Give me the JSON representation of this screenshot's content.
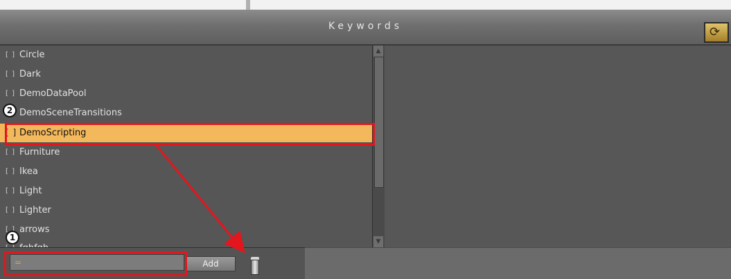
{
  "header": {
    "title": "Keywords"
  },
  "keywords": [
    {
      "check": "[ ]",
      "label": "Circle"
    },
    {
      "check": "[ ]",
      "label": "Dark"
    },
    {
      "check": "[ ]",
      "label": "DemoDataPool"
    },
    {
      "check": "[ ]",
      "label": "DemoSceneTransitions"
    },
    {
      "check": "[ ]",
      "label": "DemoScripting"
    },
    {
      "check": "[ ]",
      "label": "Furniture"
    },
    {
      "check": "[ ]",
      "label": "Ikea"
    },
    {
      "check": "[ ]",
      "label": "Light"
    },
    {
      "check": "[ ]",
      "label": "Lighter"
    },
    {
      "check": "[ ]",
      "label": "arrows"
    },
    {
      "check": "[ ]",
      "label": "fghfgh"
    }
  ],
  "bottom": {
    "input_value": "=",
    "add_label": "Add"
  },
  "callouts": {
    "one": "1",
    "two": "2"
  },
  "colors": {
    "highlight": "#e3161e",
    "selected_row": "#f4b85c"
  }
}
